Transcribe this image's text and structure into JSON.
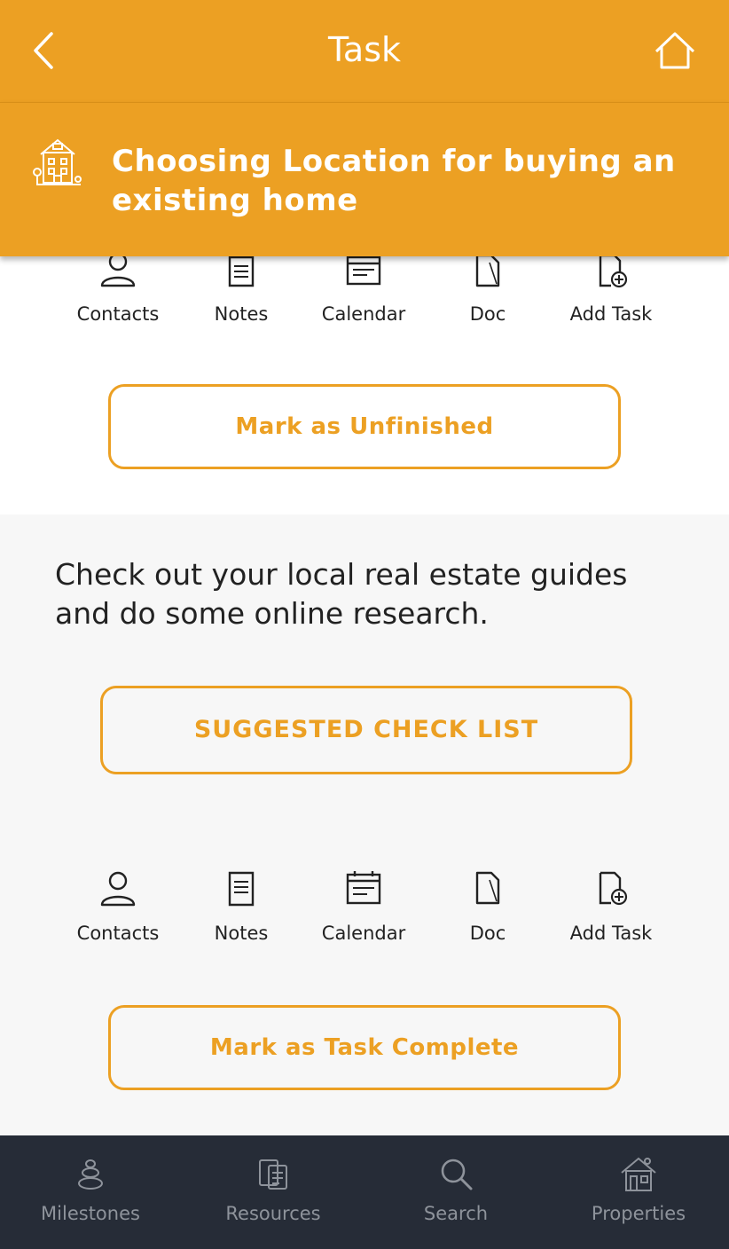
{
  "header": {
    "title": "Task",
    "back_icon": "chevron-left-icon",
    "home_icon": "home-icon"
  },
  "task": {
    "heading": "Choosing Location for buying an existing home",
    "icon": "house-icon"
  },
  "actions_top": [
    {
      "label": "Contacts",
      "icon": "person-icon"
    },
    {
      "label": "Notes",
      "icon": "notes-icon"
    },
    {
      "label": "Calendar",
      "icon": "calendar-icon"
    },
    {
      "label": "Doc",
      "icon": "document-icon"
    },
    {
      "label": "Add Task",
      "icon": "add-task-icon"
    }
  ],
  "buttons": {
    "mark_unfinished": "Mark as Unfinished",
    "suggested_checklist": "SUGGESTED CHECK LIST",
    "mark_complete": "Mark as Task Complete"
  },
  "description": "Check out your local real estate guides and do some online research.",
  "actions_bottom": [
    {
      "label": "Contacts",
      "icon": "person-icon"
    },
    {
      "label": "Notes",
      "icon": "notes-icon"
    },
    {
      "label": "Calendar",
      "icon": "calendar-icon"
    },
    {
      "label": "Doc",
      "icon": "document-icon"
    },
    {
      "label": "Add Task",
      "icon": "add-task-icon"
    }
  ],
  "bottom_nav": [
    {
      "label": "Milestones",
      "icon": "stones-icon"
    },
    {
      "label": "Resources",
      "icon": "resources-icon"
    },
    {
      "label": "Search",
      "icon": "search-icon"
    },
    {
      "label": "Properties",
      "icon": "properties-icon"
    }
  ],
  "colors": {
    "accent": "#ECA023",
    "nav_bg": "#262c37",
    "nav_text": "#8e939b",
    "section_bg": "#f7f7f7"
  }
}
